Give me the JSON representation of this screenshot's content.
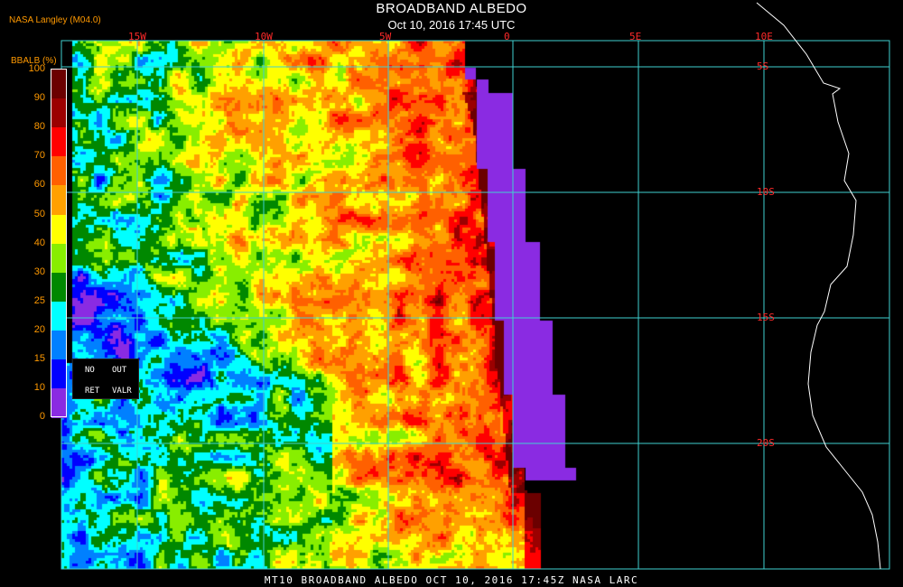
{
  "header": {
    "title": "BROADBAND ALBEDO",
    "subtitle": "Oct 10, 2016 17:45 UTC",
    "credit": "NASA Langley (M04.0)"
  },
  "legend": {
    "title": "BBALB (%)",
    "levels": [
      {
        "label": "100",
        "color": "#6b0000"
      },
      {
        "label": "90",
        "color": "#9b0000"
      },
      {
        "label": "80",
        "color": "#ff0000"
      },
      {
        "label": "70",
        "color": "#ff6000"
      },
      {
        "label": "60",
        "color": "#ffa000"
      },
      {
        "label": "50",
        "color": "#ffff00"
      },
      {
        "label": "40",
        "color": "#88ee00"
      },
      {
        "label": "30",
        "color": "#008800"
      },
      {
        "label": "25",
        "color": "#00ffff"
      },
      {
        "label": "20",
        "color": "#0080ff"
      },
      {
        "label": "15",
        "color": "#0000ff"
      },
      {
        "label": "10",
        "color": "#8a2be2"
      },
      {
        "label": "0",
        "color": ""
      }
    ],
    "no_retrieval": {
      "line1a": "NO",
      "line1b": "OUT",
      "line2a": "RET",
      "line2b": "VALR"
    }
  },
  "grid": {
    "longitude_labels": [
      "15W",
      "10W",
      "5W",
      "0",
      "5E",
      "10E"
    ],
    "latitude_labels": [
      "5S",
      "10S",
      "15S",
      "20S"
    ],
    "line_color": "#40d0d0",
    "label_color": "#ff2a2a"
  },
  "footer": {
    "caption": "MT10   BROADBAND ALBEDO   OCT 10, 2016 17:45Z   NASA LARC"
  },
  "colors": {
    "background": "#000000",
    "coast": "#ffffff",
    "no_retrieval": "#8a2be2"
  }
}
